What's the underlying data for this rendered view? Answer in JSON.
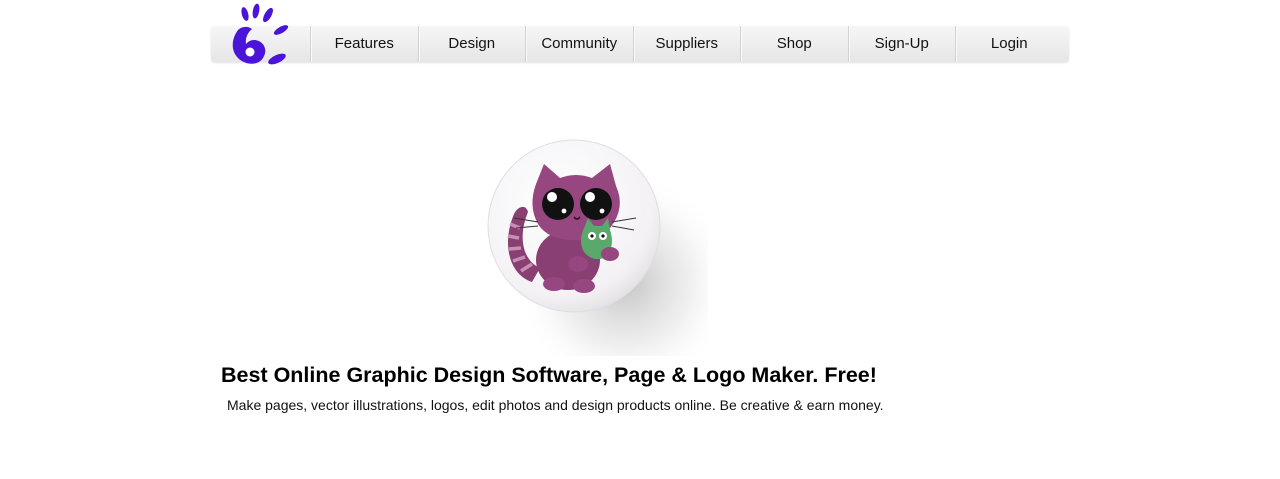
{
  "nav": {
    "items": [
      {
        "label": "Features"
      },
      {
        "label": "Design"
      },
      {
        "label": "Community"
      },
      {
        "label": "Suppliers"
      },
      {
        "label": "Shop"
      },
      {
        "label": "Sign-Up"
      },
      {
        "label": "Login"
      }
    ]
  },
  "logo": {
    "icon": "handprint-logo",
    "color": "#4a14d9"
  },
  "hero": {
    "image": "purple-cat-pin-button",
    "headline": "Best Online Graphic Design Software, Page & Logo Maker. Free!",
    "subline": "Make pages, vector illustrations, logos, edit photos and design products online. Be creative & earn money."
  }
}
